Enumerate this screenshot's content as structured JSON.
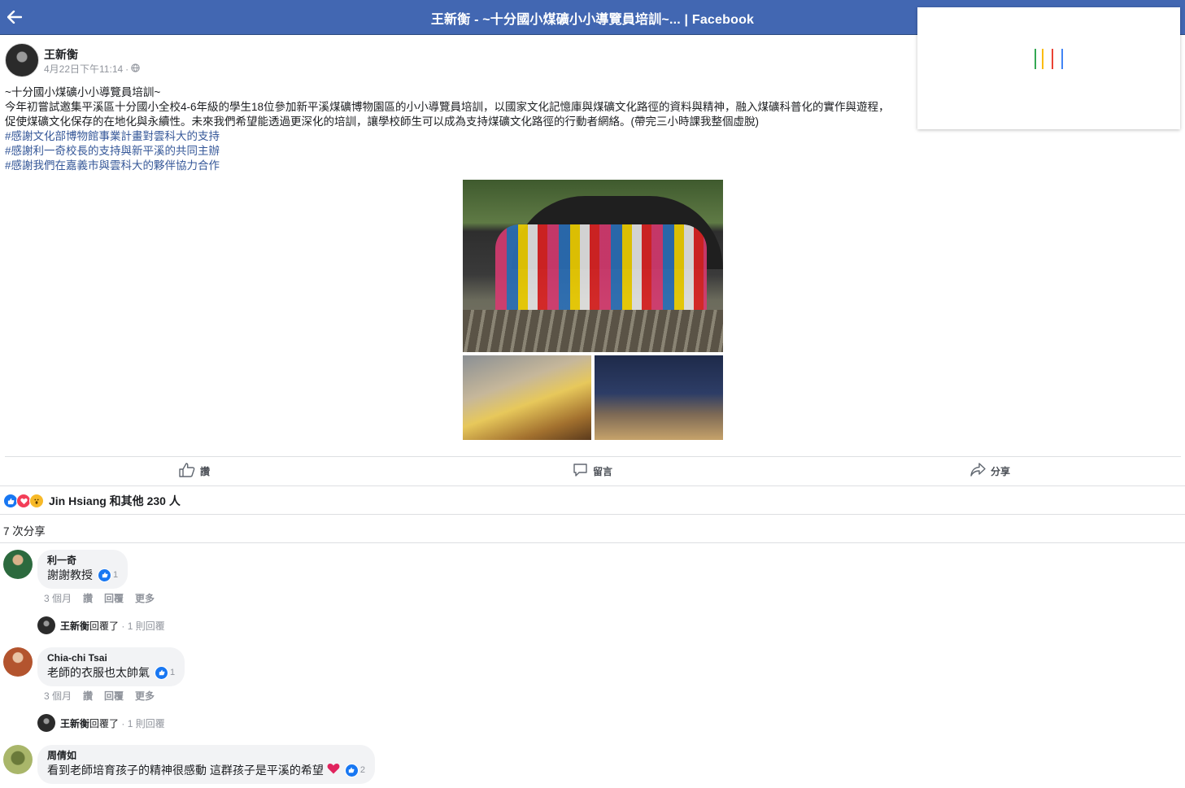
{
  "topbar": {
    "title": "王新衡 - ~十分國小煤礦小小導覽員培訓~... | Facebook"
  },
  "post": {
    "author": "王新衡",
    "timestamp": "4月22日下午11:14",
    "meta_sep": "·",
    "lines": [
      "~十分國小煤礦小小導覽員培訓~",
      "今年初嘗試邀集平溪區十分國小全校4-6年級的學生18位參加新平溪煤礦博物園區的小小導覽員培訓，以國家文化記憶庫與煤礦文化路徑的資料與精神，融入煤礦科普化的實作與遊程，",
      "促使煤礦文化保存的在地化與永續性。未來我們希望能透過更深化的培訓，讓學校師生可以成為支持煤礦文化路徑的行動者網絡。(帶完三小時課我整個虛脫)"
    ],
    "hashtags": [
      "#感謝文化部博物館事業計畫對雲科大的支持",
      "#感謝利一奇校長的支持與新平溪的共同主辦",
      "#感謝我們在嘉義市與雲科大的夥伴協力合作"
    ]
  },
  "actions": {
    "like": "讚",
    "comment": "留言",
    "share": "分享"
  },
  "reactions": {
    "summary": "Jin Hsiang 和其他 230 人"
  },
  "shares": "7 次分享",
  "comments": [
    {
      "name": "利一奇",
      "text": "謝謝教授",
      "likes": "1",
      "time": "3 個月",
      "like": "讚",
      "reply": "回覆",
      "more": "更多",
      "reply_author": "王新衡",
      "reply_text": "回覆了",
      "reply_count": " · 1 則回覆"
    },
    {
      "name": "Chia-chi Tsai",
      "text": "老師的衣服也太帥氣",
      "likes": "1",
      "time": "3 個月",
      "like": "讚",
      "reply": "回覆",
      "more": "更多",
      "reply_author": "王新衡",
      "reply_text": "回覆了",
      "reply_count": " · 1 則回覆"
    },
    {
      "name": "周倩如",
      "text": "看到老師培育孩子的精神很感動 這群孩子是平溪的希望",
      "likes": "2"
    }
  ],
  "colors": {
    "topbar": "#4267b2",
    "hashtag": "#365899",
    "like_blue": "#1877f2"
  }
}
